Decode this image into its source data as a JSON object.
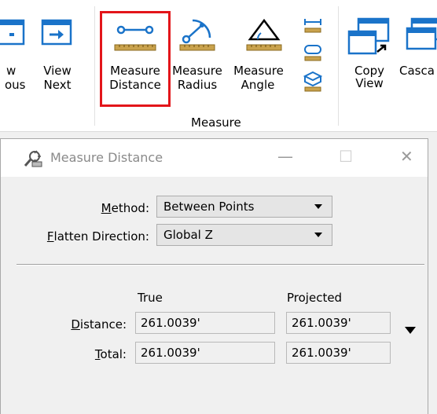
{
  "ribbon": {
    "buttons": {
      "view_previous": {
        "line1": "w",
        "line2": "ous"
      },
      "view_next": {
        "line1": "View",
        "line2": "Next"
      },
      "measure_distance": {
        "line1": "Measure",
        "line2": "Distance"
      },
      "measure_radius": {
        "line1": "Measure",
        "line2": "Radius"
      },
      "measure_angle": {
        "line1": "Measure",
        "line2": "Angle"
      },
      "copy_view": {
        "line1": "Copy",
        "line2": "View"
      },
      "cascade": {
        "line1": "Casca"
      }
    },
    "group_label": "Measure",
    "highlight_color": "#e3151a",
    "icon_blue": "#1a73c9",
    "ruler_color": "#c9a24d"
  },
  "dialog": {
    "title": "Measure Distance",
    "controls": {
      "minimize": "—",
      "maximize": "☐",
      "close": "✕"
    },
    "method": {
      "label_pre": "",
      "label_ul": "M",
      "label_post": "ethod:",
      "value": "Between Points"
    },
    "flatten": {
      "label_pre": "",
      "label_ul": "F",
      "label_post": "latten Direction:",
      "value": "Global Z"
    },
    "columns": {
      "true": "True",
      "projected": "Projected"
    },
    "distance": {
      "label_pre": "",
      "label_ul": "D",
      "label_post": "istance:",
      "true_value": "261.0039'",
      "projected_value": "261.0039'"
    },
    "total": {
      "label_pre": "",
      "label_ul": "T",
      "label_post": "otal:",
      "true_value": "261.0039'",
      "projected_value": "261.0039'"
    }
  }
}
